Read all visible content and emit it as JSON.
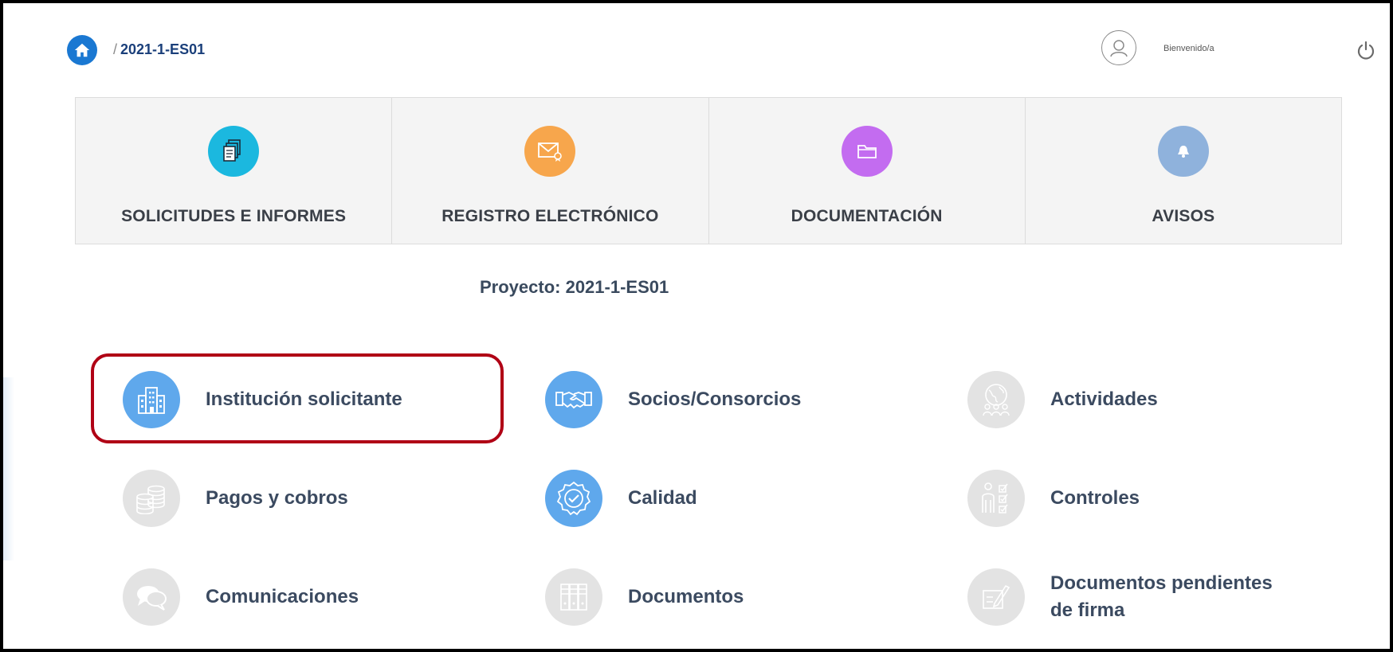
{
  "header": {
    "breadcrumb_sep": "/",
    "breadcrumb_project": "2021-1-ES01",
    "welcome": "Bienvenido/a"
  },
  "nav_tiles": [
    {
      "label": "SOLICITUDES E INFORMES",
      "icon": "documents-icon",
      "color": "#1bb8df"
    },
    {
      "label": "REGISTRO ELECTRÓNICO",
      "icon": "certified-mail-icon",
      "color": "#f7a64c"
    },
    {
      "label": "DOCUMENTACIÓN",
      "icon": "folder-icon",
      "color": "#c36cf0"
    },
    {
      "label": "AVISOS",
      "icon": "bell-icon",
      "color": "#8fb2dc"
    }
  ],
  "project_title": "Proyecto: 2021-1-ES01",
  "modules": [
    {
      "label": "Institución solicitante",
      "icon": "building-icon",
      "active": true,
      "highlighted": true
    },
    {
      "label": "Socios/Consorcios",
      "icon": "handshake-icon",
      "active": true
    },
    {
      "label": "Actividades",
      "icon": "globe-people-icon",
      "active": false
    },
    {
      "label": "Pagos y cobros",
      "icon": "coins-icon",
      "active": false
    },
    {
      "label": "Calidad",
      "icon": "quality-badge-icon",
      "active": true
    },
    {
      "label": "Controles",
      "icon": "checklist-person-icon",
      "active": false
    },
    {
      "label": "Comunicaciones",
      "icon": "chat-bubbles-icon",
      "active": false
    },
    {
      "label": "Documentos",
      "icon": "binders-icon",
      "active": false
    },
    {
      "label": "Documentos pendientes",
      "label2": "de firma",
      "icon": "sign-document-icon",
      "active": false
    }
  ],
  "colors": {
    "active_icon": "#5fa8ec",
    "inactive_icon": "#e3e3e3",
    "highlight": "#b00015",
    "home": "#1a78d2"
  }
}
